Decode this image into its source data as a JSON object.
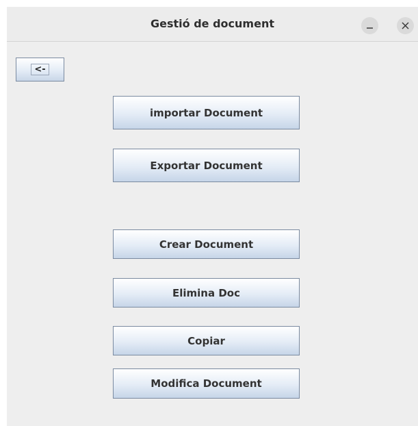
{
  "window": {
    "title": "Gestió de document",
    "minimize_icon": "minimize-icon",
    "close_icon": "close-icon"
  },
  "back_button": {
    "label": "<-"
  },
  "buttons": {
    "importar": "importar Document",
    "exportar": "Exportar Document",
    "crear": "Crear Document",
    "elimina": "Elimina Doc",
    "copiar": "Copiar",
    "modifica": "Modifica Document"
  },
  "colors": {
    "window_bg": "#eeeeee",
    "button_border": "#7a8aa0",
    "button_gradient_bottom": "#c6d5e8"
  }
}
